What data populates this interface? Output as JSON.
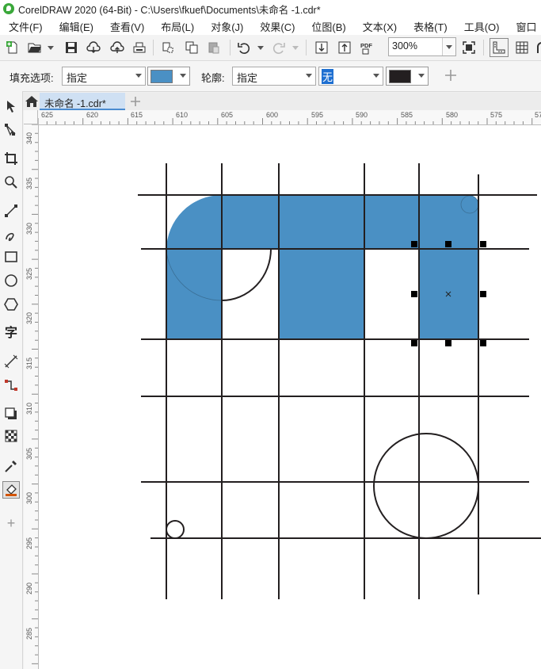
{
  "window": {
    "title": "CorelDRAW 2020 (64-Bit) - C:\\Users\\fkuef\\Documents\\未命名 -1.cdr*"
  },
  "menu": [
    "文件(F)",
    "编辑(E)",
    "查看(V)",
    "布局(L)",
    "对象(J)",
    "效果(C)",
    "位图(B)",
    "文本(X)",
    "表格(T)",
    "工具(O)",
    "窗口"
  ],
  "toolbar": {
    "zoom": "300%",
    "pdf_label": "PDF"
  },
  "properties": {
    "fill_label": "填充选项:",
    "fill_mode": "指定",
    "fill_color": "#4a90c4",
    "outline_label": "轮廓:",
    "outline_mode": "指定",
    "outline_width": "无",
    "outline_color": "#231f20"
  },
  "document": {
    "tab_label": "未命名 -1.cdr*"
  },
  "rulers": {
    "horizontal": [
      "625",
      "620",
      "615",
      "610",
      "605",
      "600",
      "595",
      "590",
      "585",
      "580",
      "575",
      "57"
    ],
    "vertical": [
      "340",
      "335",
      "330",
      "325",
      "320",
      "315",
      "310",
      "305",
      "300",
      "295",
      "290",
      "285"
    ]
  },
  "tools": [
    "pick-tool",
    "shape-tool",
    "crop-tool",
    "zoom-tool",
    "freehand-tool",
    "artistic-media-tool",
    "rectangle-tool",
    "ellipse-tool",
    "polygon-tool",
    "text-tool",
    "parallel-dimension-tool",
    "connector-tool",
    "drop-shadow-tool",
    "transparency-tool",
    "eyedropper-tool",
    "interactive-fill-tool",
    "add-tool"
  ],
  "text_tool_glyph": "字",
  "add_glyph": "+"
}
